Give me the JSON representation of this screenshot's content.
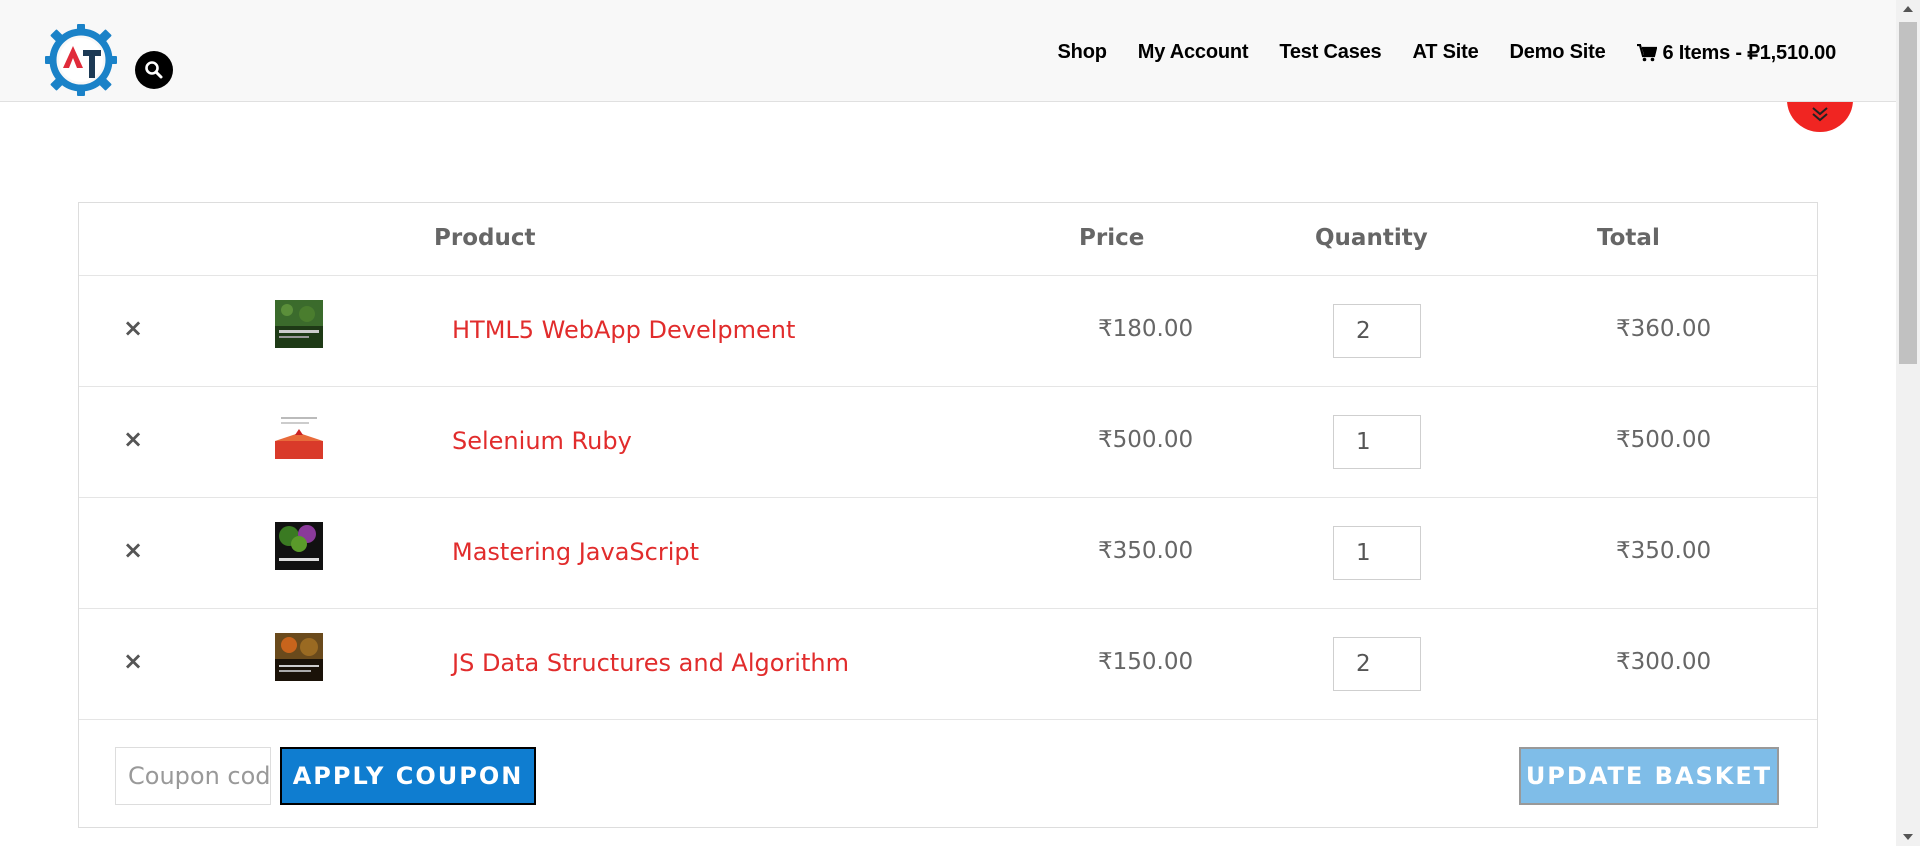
{
  "header": {
    "nav": [
      {
        "label": "Shop"
      },
      {
        "label": "My Account"
      },
      {
        "label": "Test Cases"
      },
      {
        "label": "AT Site"
      },
      {
        "label": "Demo Site"
      }
    ],
    "cart_summary": "6 Items - ₽1,510.00"
  },
  "table": {
    "headers": {
      "product": "Product",
      "price": "Price",
      "quantity": "Quantity",
      "total": "Total"
    },
    "rows": [
      {
        "remove": "×",
        "name": "HTML5 WebApp Develpment",
        "price": "₹180.00",
        "qty": "2",
        "total": "₹360.00",
        "thumb_color": "#3b6b2c"
      },
      {
        "remove": "×",
        "name": "Selenium Ruby",
        "price": "₹500.00",
        "qty": "1",
        "total": "₹500.00",
        "thumb_color": "#d93a2a"
      },
      {
        "remove": "×",
        "name": "Mastering JavaScript",
        "price": "₹350.00",
        "qty": "1",
        "total": "₹350.00",
        "thumb_color": "#2e5a1c"
      },
      {
        "remove": "×",
        "name": "JS Data Structures and Algorithm",
        "price": "₹150.00",
        "qty": "2",
        "total": "₹300.00",
        "thumb_color": "#6a4a1c"
      }
    ]
  },
  "actions": {
    "coupon_placeholder": "Coupon code",
    "apply_label": "APPLY COUPON",
    "update_label": "UPDATE BASKET"
  },
  "colors": {
    "accent_red": "#e12c2c",
    "primary_blue": "#0f7dd0",
    "disabled_blue": "#7fbde8"
  }
}
